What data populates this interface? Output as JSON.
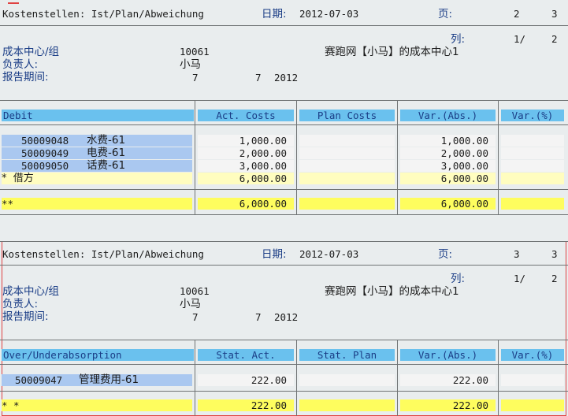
{
  "page1": {
    "report_title": "Kostenstellen: Ist/Plan/Abweichung",
    "date_label": "日期:",
    "date_value": "2012-07-03",
    "page_label": "页:",
    "page_current": "2",
    "page_total": "3",
    "col_label": "列:",
    "col_current": "1/",
    "col_total": "2",
    "cost_center_label": "成本中心/组",
    "cost_center_value": "10061",
    "cost_center_desc": "赛跑网【小马】的成本中心1",
    "responsible_label": "负责人:",
    "responsible_value": "小马",
    "period_label": "报告期间:",
    "period_from": "7",
    "period_to": "7",
    "period_year": "2012",
    "headers": {
      "first": "Debit",
      "act": "Act. Costs",
      "plan": "Plan Costs",
      "var_abs": "Var.(Abs.)",
      "var_pct": "Var.(%)"
    },
    "rows": [
      {
        "code": "50009048",
        "name": "水费-61",
        "act": "1,000.00",
        "var": "1,000.00"
      },
      {
        "code": "50009049",
        "name": "电费-61",
        "act": "2,000.00",
        "var": "2,000.00"
      },
      {
        "code": "50009050",
        "name": "话费-61",
        "act": "3,000.00",
        "var": "3,000.00"
      }
    ],
    "subtotal": {
      "label": "*  借方",
      "act": "6,000.00",
      "var": "6,000.00"
    },
    "total": {
      "label": "**",
      "act": "6,000.00",
      "var": "6,000.00"
    }
  },
  "page2": {
    "report_title": "Kostenstellen: Ist/Plan/Abweichung",
    "date_label": "日期:",
    "date_value": "2012-07-03",
    "page_label": "页:",
    "page_current": "3",
    "page_total": "3",
    "col_label": "列:",
    "col_current": "1/",
    "col_total": "2",
    "cost_center_label": "成本中心/组",
    "cost_center_value": "10061",
    "cost_center_desc": "赛跑网【小马】的成本中心1",
    "responsible_label": "负责人:",
    "responsible_value": "小马",
    "period_label": "报告期间:",
    "period_from": "7",
    "period_to": "7",
    "period_year": "2012",
    "headers": {
      "first": "Over/Underabsorption",
      "act": "Stat. Act.",
      "plan": "Stat. Plan",
      "var_abs": "Var.(Abs.)",
      "var_pct": "Var.(%)"
    },
    "rows": [
      {
        "code": "50009047",
        "name": "管理费用-61",
        "act": "222.00",
        "var": "222.00"
      }
    ],
    "total": {
      "label": "* *",
      "act": "222.00",
      "var": "222.00"
    }
  }
}
